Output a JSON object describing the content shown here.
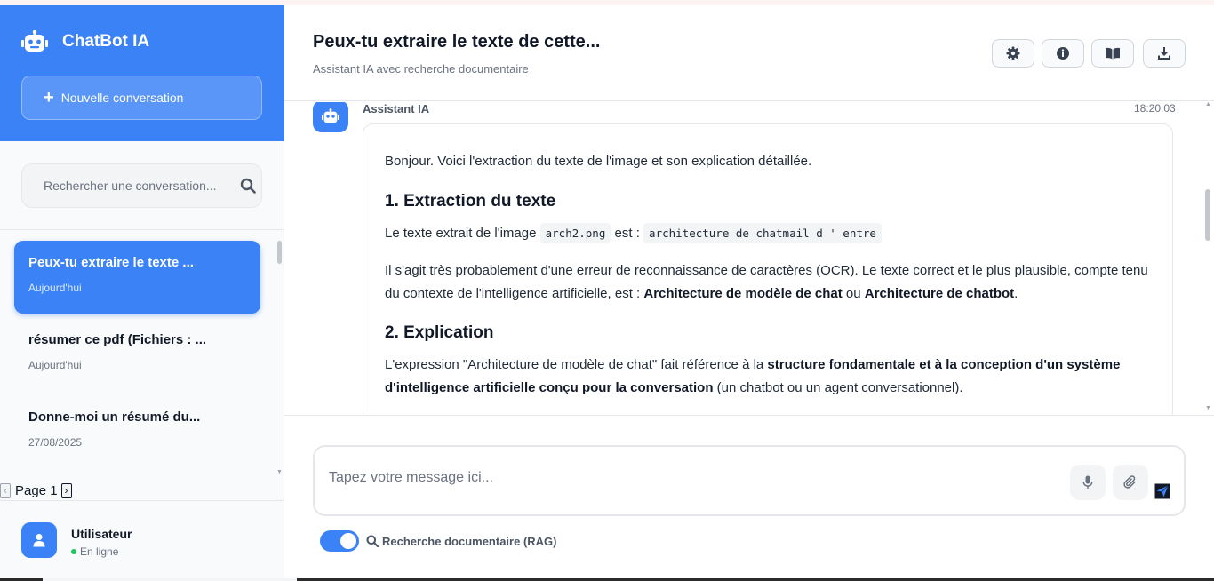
{
  "app": {
    "title": "ChatBot IA",
    "new_conversation": "Nouvelle conversation"
  },
  "search": {
    "placeholder": "Rechercher une conversation..."
  },
  "conversations": [
    {
      "title": "Peux-tu extraire le texte ...",
      "date": "Aujourd'hui",
      "active": true
    },
    {
      "title": "résumer ce pdf (Fichiers : ...",
      "date": "Aujourd'hui",
      "active": false
    },
    {
      "title": "Donne-moi un résumé du...",
      "date": "27/08/2025",
      "active": false
    }
  ],
  "pagination": {
    "label": "Page 1"
  },
  "user": {
    "name": "Utilisateur",
    "status": "En ligne"
  },
  "header": {
    "title": "Peux-tu extraire le texte de cette...",
    "subtitle": "Assistant IA avec recherche documentaire",
    "buttons": [
      "settings-icon",
      "info-icon",
      "book-icon",
      "download-icon"
    ]
  },
  "message": {
    "author": "Assistant IA",
    "time": "18:20:03",
    "intro": "Bonjour. Voici l'extraction du texte de l'image et son explication détaillée.",
    "h1": "1. Extraction du texte",
    "p1_a": "Le texte extrait de l'image ",
    "p1_code1": "arch2.png",
    "p1_b": " est : ",
    "p1_code2": "architecture de chatmail d ' entre",
    "p2_a": "Il s'agit très probablement d'une erreur de reconnaissance de caractères (OCR). Le texte correct et le plus plausible, compte tenu du contexte de l'intelligence artificielle, est : ",
    "p2_b1": "Architecture de modèle de chat",
    "p2_c": " ou ",
    "p2_b2": "Architecture de chatbot",
    "p2_d": ".",
    "h2": "2. Explication",
    "p3_a": "L'expression \"Architecture de modèle de chat\" fait référence à la ",
    "p3_b": "structure fondamentale et à la conception d'un système d'intelligence artificielle conçu pour la conversation",
    "p3_c": " (un chatbot ou un agent conversationnel)."
  },
  "composer": {
    "placeholder": "Tapez votre message ici..."
  },
  "rag": {
    "label": "Recherche documentaire (RAG)",
    "enabled": true
  },
  "colors": {
    "accent": "#3b82f6",
    "status_online": "#22c55e"
  }
}
